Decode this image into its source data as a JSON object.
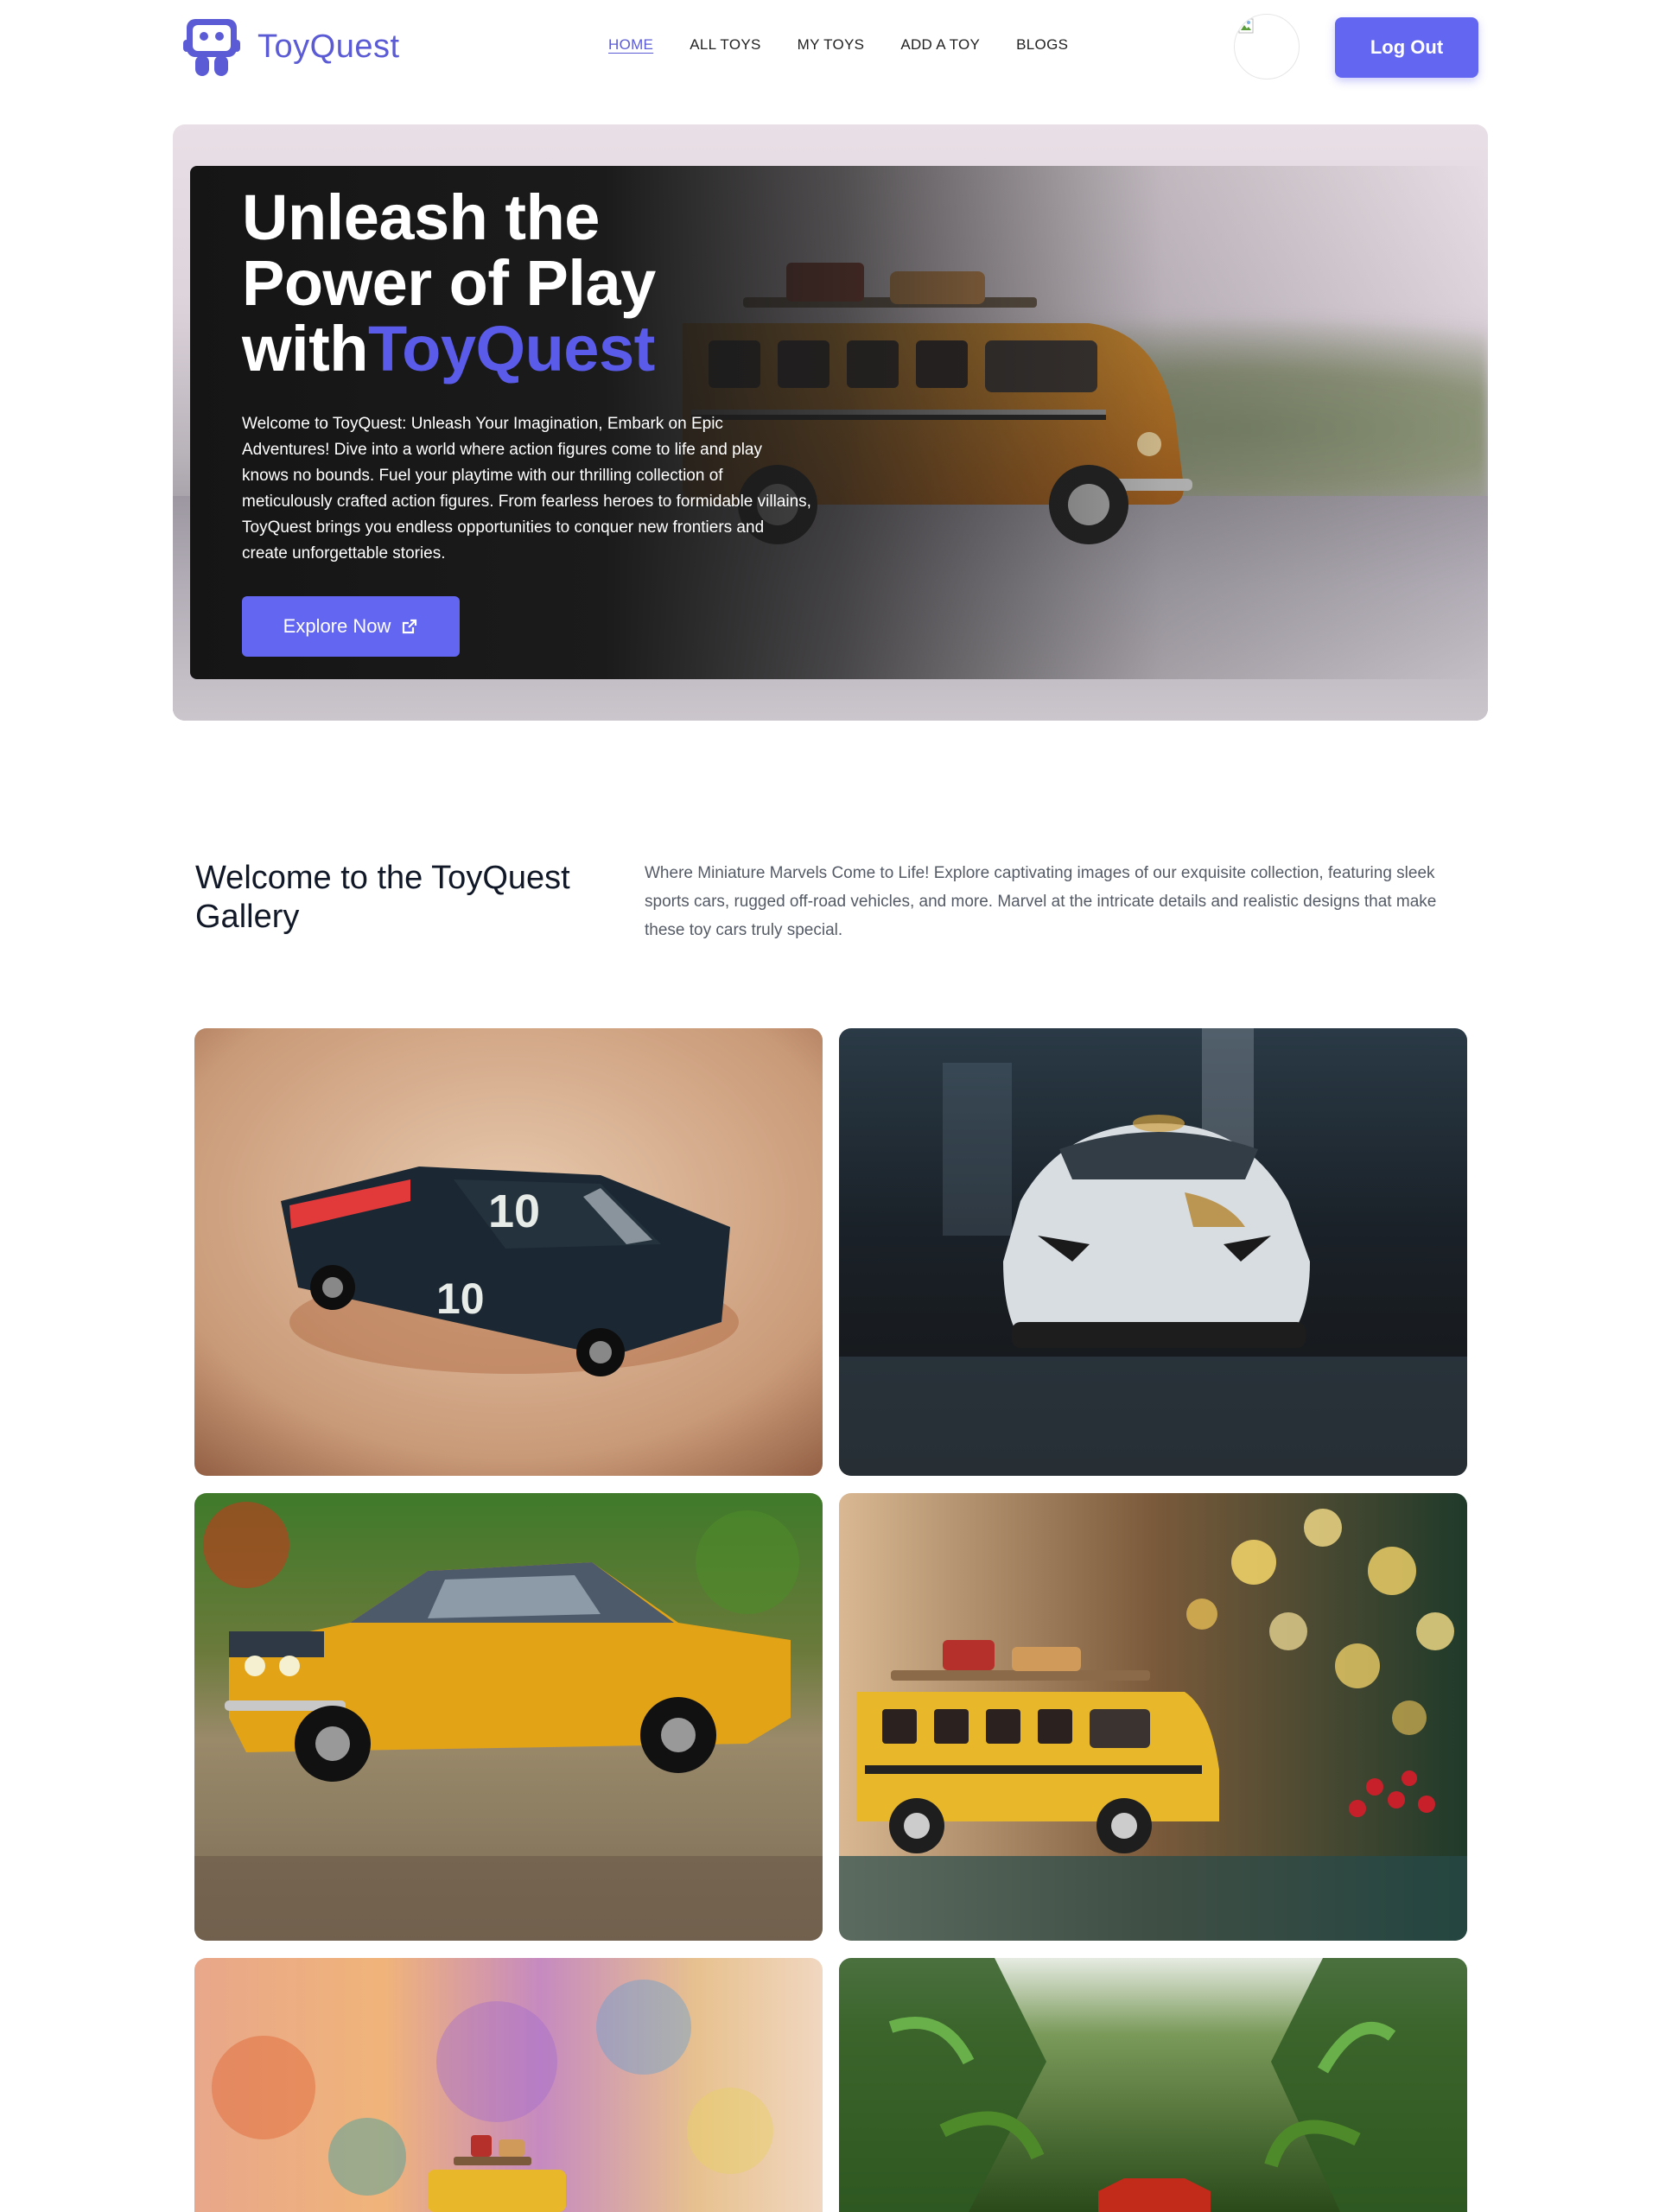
{
  "navbar": {
    "brand_name": "ToyQuest",
    "links": [
      {
        "label": "HOME",
        "active": true
      },
      {
        "label": "ALL TOYS",
        "active": false
      },
      {
        "label": "MY TOYS",
        "active": false
      },
      {
        "label": "ADD A TOY",
        "active": false
      },
      {
        "label": "BLOGS",
        "active": false
      }
    ],
    "logout_label": "Log Out",
    "accent_color": "#6366f1"
  },
  "hero": {
    "title_line1": "Unleash the",
    "title_line2": "Power of Play",
    "title_line3_prefix": "with",
    "title_line3_accent": "ToyQuest",
    "description": "Welcome to ToyQuest: Unleash Your Imagination, Embark on Epic Adventures! Dive into a world where action figures come to life and play knows no bounds. Fuel your playtime with our thrilling collection of meticulously crafted action figures. From fearless heroes to formidable villains, ToyQuest brings you endless opportunities to conquer new frontiers and create unforgettable stories.",
    "cta_label": "Explore Now",
    "cta_icon": "external-link-icon"
  },
  "gallery": {
    "title": "Welcome to the ToyQuest Gallery",
    "description": "Where Miniature Marvels Come to Life! Explore captivating images of our exquisite collection, featuring sleek sports cars, rugged off-road vehicles, and more. Marvel at the intricate details and realistic designs that make these toy cars truly special.",
    "images": [
      {
        "subject": "black race car number 10",
        "number_label": "10"
      },
      {
        "subject": "white toy car on dark surface"
      },
      {
        "subject": "yellow classic coupe on pavement"
      },
      {
        "subject": "yellow bus with christmas lights"
      },
      {
        "subject": "yellow bus with colorful van background"
      },
      {
        "subject": "red car in green foliage"
      }
    ]
  }
}
